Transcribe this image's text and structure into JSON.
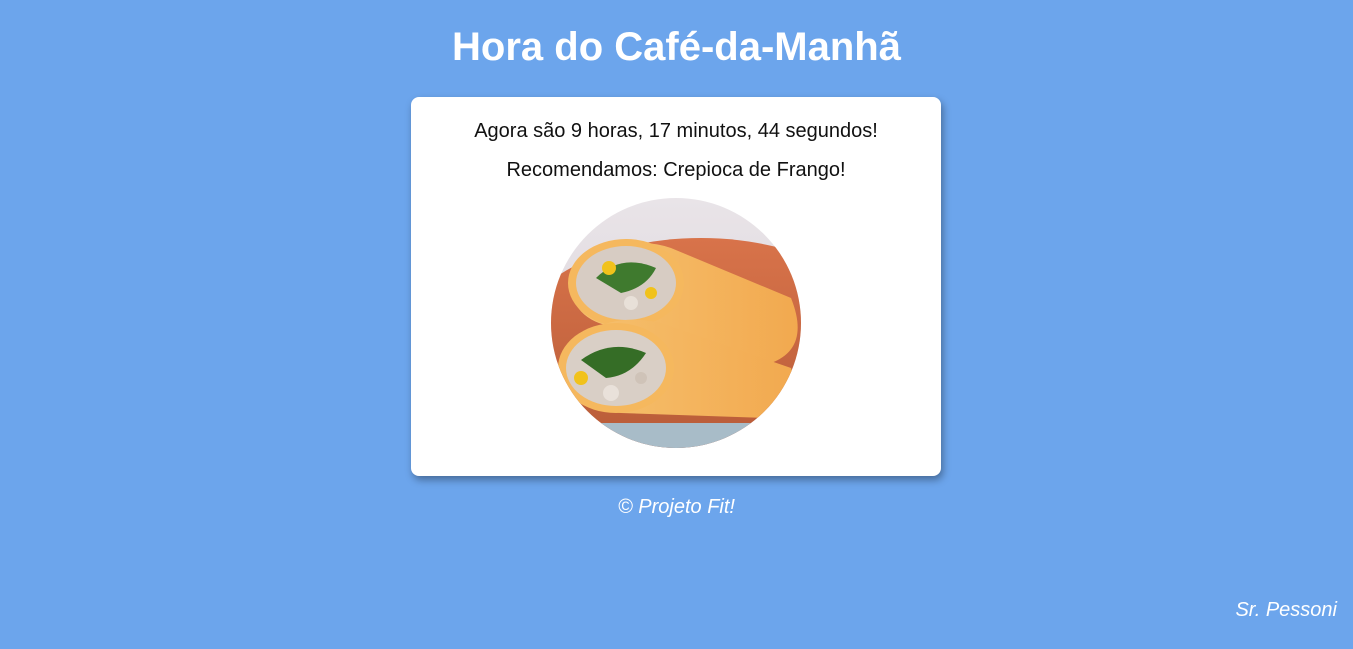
{
  "header": {
    "title": "Hora do Café-da-Manhã"
  },
  "card": {
    "time_text": "Agora são 9 horas, 17 minutos, 44 segundos!",
    "recommendation_text": "Recomendamos: Crepioca de Frango!",
    "image": {
      "subject": "crepioca-de-frango"
    }
  },
  "footer": {
    "copyright": "© Projeto Fit!",
    "author": "Sr. Pessoni"
  },
  "colors": {
    "background": "#6ca5ec",
    "card": "#ffffff",
    "heading_text": "#ffffff",
    "body_text": "#111111"
  }
}
